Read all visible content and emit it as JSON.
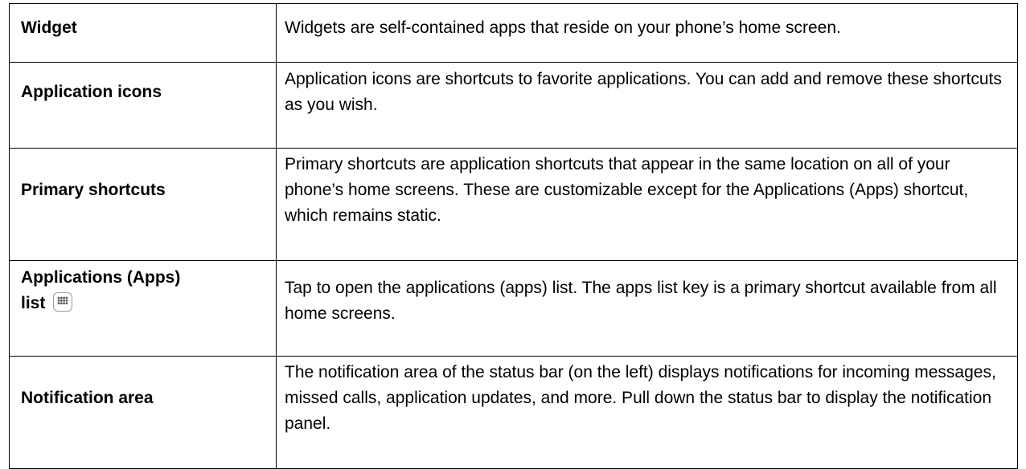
{
  "rows": [
    {
      "term": "Widget",
      "description": "Widgets are self-contained apps that reside on your phone’s home screen."
    },
    {
      "term": "Application icons",
      "description": "Application icons are shortcuts to favorite applications. You can add and remove these shortcuts as you wish."
    },
    {
      "term": "Primary shortcuts",
      "description": "Primary shortcuts are application shortcuts that appear in the same location on all of your phone’s home screens. These are customizable except for the Applications (Apps) shortcut, which remains static."
    },
    {
      "term_line1": "Applications (Apps)",
      "term_line2": "list",
      "icon": "apps-grid-icon",
      "description": "Tap to open the applications (apps) list. The apps list key is a primary shortcut available from all home screens."
    },
    {
      "term": "Notification area",
      "description": "The notification area of the status bar (on the left) displays notifications for incoming messages, missed calls, application updates, and more. Pull down the status bar to display the notification panel."
    }
  ]
}
